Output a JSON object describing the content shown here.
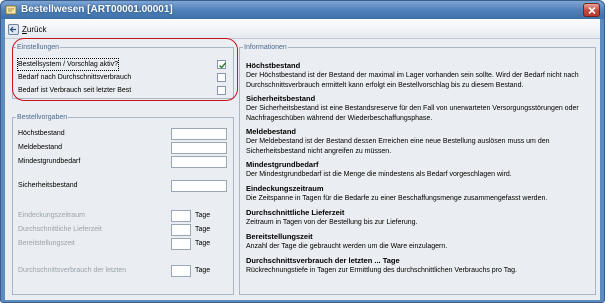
{
  "window": {
    "title": "Bestellwesen [ART00001.00001]"
  },
  "toolbar": {
    "back_label_u": "Z",
    "back_label_rest": "urück"
  },
  "settings": {
    "legend": "Einstellungen",
    "items": [
      {
        "label": "Bestellsystem / Vorschlag aktiv?",
        "checked": true
      },
      {
        "label": "Bedarf nach Durchschnittsverbrauch",
        "checked": false
      },
      {
        "label": "Bedarf ist Verbrauch seit letzter Best",
        "checked": false
      }
    ]
  },
  "defaults": {
    "legend": "Bestellvorgaben",
    "fields": [
      {
        "label": "Höchstbestand"
      },
      {
        "label": "Meldebestand"
      },
      {
        "label": "Mindestgrundbedarf"
      },
      {
        "label": "Sicherheitsbestand"
      },
      {
        "label": "Eindeckungszeitraum",
        "unit": "Tage"
      },
      {
        "label": "Durchschnittliche Lieferzeit",
        "unit": "Tage"
      },
      {
        "label": "Bereitstellungszeit",
        "unit": "Tage"
      },
      {
        "label": "Durchschnittsverbrauch der letzten",
        "unit": "Tage"
      }
    ]
  },
  "info": {
    "legend": "Informationen",
    "entries": [
      {
        "title": "Höchstbestand",
        "text": "Der Höchstbestand ist der Bestand der maximal im Lager vorhanden sein sollte. Wird der Bedarf nicht nach Durchschnittsverbrauch ermittelt kann erfolgt ein Bestellvorschlag bis zu diesem Bestand."
      },
      {
        "title": "Sicherheitsbestand",
        "text": "Der Sicherheitsbestand ist eine Bestandsreserve für den Fall von unerwarteten Versorgungsstörungen oder Nachfrageschüben während der Wiederbeschaffungsphase."
      },
      {
        "title": "Meldebestand",
        "text": "Der Meldebestand ist der Bestand dessen Erreichen eine neue Bestellung auslösen muss um den Sicherheitsbestand nicht angreifen zu müssen."
      },
      {
        "title": "Mindestgrundbedarf",
        "text": "Der Mindestgrundbedarf ist die Menge die mindestens als Bedarf vorgeschlagen wird."
      },
      {
        "title": "Eindeckungszeitraum",
        "text": "Die Zeitspanne in Tagen für die Bedarfe zu einer Beschaffungsmenge zusammengefasst werden."
      },
      {
        "title": "Durchschnittliche Lieferzeit",
        "text": "Zeitraum in Tagen von der Bestellung bis zur Lieferung."
      },
      {
        "title": "Bereitstellungszeit",
        "text": "Anzahl der Tage die gebraucht werden um die Ware einzulagern."
      },
      {
        "title": "Durchschnittsverbrauch der letzten ... Tage",
        "text": "Rückrechnungstiefe in Tagen zur Ermittlung des durchschnittlichen Verbrauchs pro Tag."
      }
    ]
  }
}
